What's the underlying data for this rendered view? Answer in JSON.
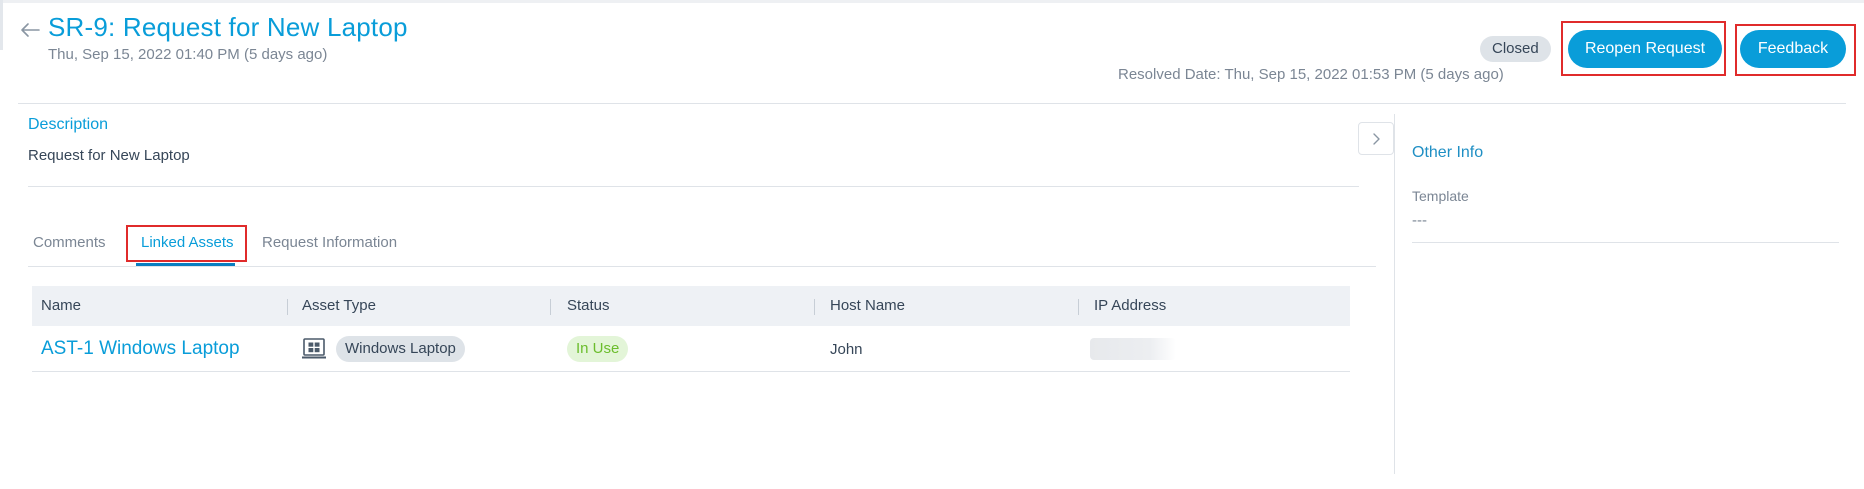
{
  "header": {
    "title": "SR-9: Request for New Laptop",
    "created": "Thu, Sep 15, 2022 01:40 PM (5 days ago)",
    "status": "Closed",
    "resolved": "Resolved Date: Thu, Sep 15, 2022 01:53 PM (5 days ago)",
    "reopen_label": "Reopen Request",
    "feedback_label": "Feedback",
    "back_icon": "arrow-left-icon"
  },
  "description": {
    "label": "Description",
    "text": "Request for New Laptop"
  },
  "tabs": [
    {
      "label": "Comments",
      "active": false
    },
    {
      "label": "Linked Assets",
      "active": true
    },
    {
      "label": "Request Information",
      "active": false
    }
  ],
  "table": {
    "columns": [
      "Name",
      "Asset Type",
      "Status",
      "Host Name",
      "IP Address"
    ],
    "rows": [
      {
        "name": "AST-1 Windows Laptop",
        "asset_type": "Windows Laptop",
        "asset_type_icon": "windows-laptop-icon",
        "status": "In Use",
        "host_name": "John",
        "ip_address": ""
      }
    ]
  },
  "sidebar": {
    "title": "Other Info",
    "template_label": "Template",
    "template_value": "---",
    "collapse_icon": "chevron-right-icon"
  },
  "colors": {
    "accent": "#099dd9",
    "status_in_use": "#6bbd2c",
    "highlight": "#e02b2b"
  }
}
